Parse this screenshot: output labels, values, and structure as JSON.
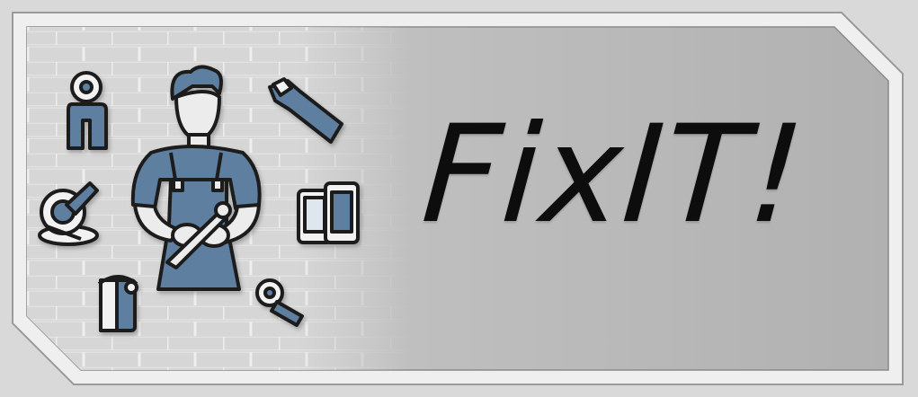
{
  "banner": {
    "title": "FixIT!",
    "colors": {
      "background": "#d9d9d9",
      "frame": "#ececec",
      "panel": "#b8b8b8",
      "brick_line": "#d2d2d2",
      "accent_blue": "#5f7fa0",
      "outline": "#1f1f1f",
      "title": "#0d0d0d"
    }
  },
  "illustration": {
    "icons": [
      "pipe-valve-icon",
      "repair-technician-icon",
      "wrench-icon",
      "polisher-disc-icon",
      "phones-icon",
      "paint-can-icon",
      "socket-wrench-icon"
    ]
  }
}
